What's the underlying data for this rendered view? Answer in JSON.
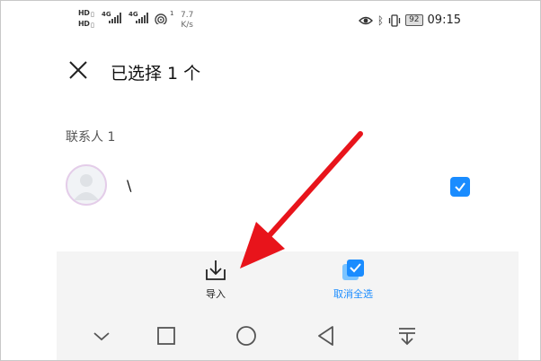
{
  "status_bar": {
    "speed_value": "7.7",
    "speed_unit": "K/s",
    "battery": "92",
    "time": "09:15",
    "network_1": "4G",
    "network_2": "4G",
    "hd_1": "HD",
    "hd_2": "HD",
    "wifi_index": "1"
  },
  "header": {
    "title": "已选择 1 个",
    "close_icon": "close-icon"
  },
  "contacts": {
    "section_title": "联系人 1",
    "items": [
      {
        "name": "\\",
        "checked": true
      }
    ]
  },
  "actions": {
    "import_label": "导入",
    "deselect_all_label": "取消全选"
  },
  "nav": {
    "icons": [
      "chevron-down-icon",
      "square-icon",
      "circle-icon",
      "back-triangle-icon",
      "pull-down-icon"
    ]
  },
  "colors": {
    "accent": "#1a8cff",
    "bar_background": "#f4f4f4",
    "annotation_arrow": "#e8141b"
  }
}
